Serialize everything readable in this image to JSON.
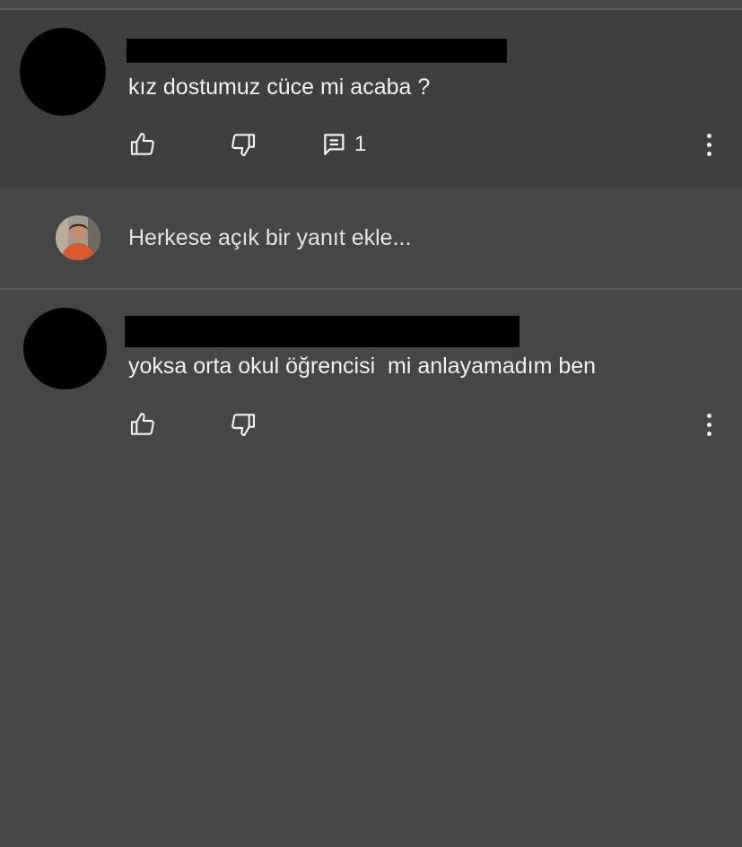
{
  "comments": [
    {
      "text": "kız dostumuz cüce mi acaba ?",
      "reply_count": "1"
    },
    {
      "text": "yoksa orta okul öğrencisi  mi anlayamadım ben"
    }
  ],
  "reply_input": {
    "placeholder": "Herkese açık bir yanıt ekle..."
  },
  "colors": {
    "background": "#464646",
    "highlighted_comment_bg": "#3f3f3f",
    "text": "#f1f1f1"
  },
  "icons": [
    "like-icon",
    "dislike-icon",
    "reply-icon",
    "more-vert-icon",
    "avatar"
  ]
}
